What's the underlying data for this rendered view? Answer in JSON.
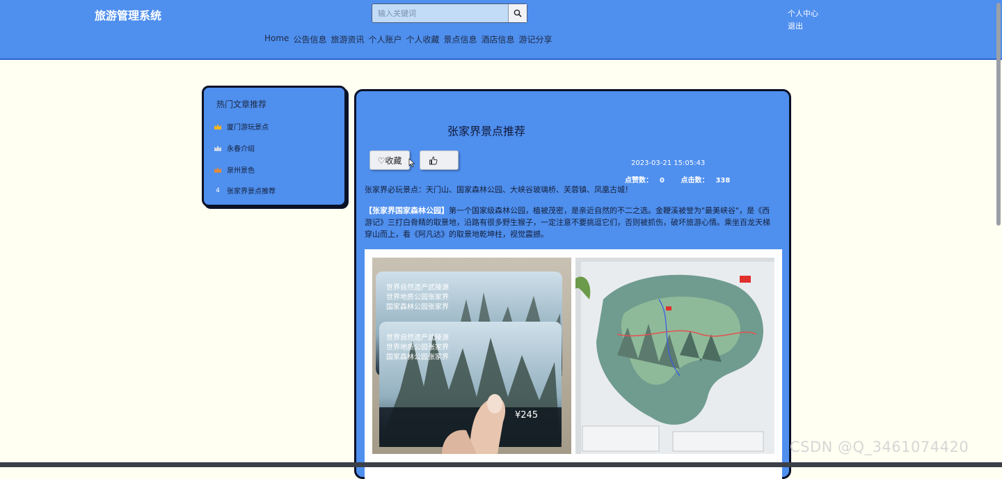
{
  "header": {
    "site_title": "旅游管理系统",
    "search_placeholder": "输入关键词",
    "nav": [
      "Home",
      "公告信息",
      "旅游资讯",
      "个人账户",
      "个人收藏",
      "景点信息",
      "酒店信息",
      "游记分享"
    ],
    "user_links": [
      "个人中心",
      "退出"
    ]
  },
  "sidebar": {
    "title": "热门文章推荐",
    "items": [
      {
        "rank": "1",
        "label": "厦门游玩景点"
      },
      {
        "rank": "2",
        "label": "永春介绍"
      },
      {
        "rank": "3",
        "label": "泉州景色"
      },
      {
        "rank": "4",
        "label": "张家界景点推荐"
      }
    ],
    "rank_colors": [
      "#f5b520",
      "#c9d2e0",
      "#e08a3c"
    ]
  },
  "article": {
    "title": "张家界景点推荐",
    "favorite_label": "♡收藏",
    "like_label": "👍",
    "date": "2023-03-21 15:05:43",
    "likes_label": "点赞数：",
    "likes": "0",
    "clicks_label": "点击数：",
    "clicks": "338",
    "intro": "张家界必玩景点：天门山、国家森林公园、大峡谷玻璃桥、芙蓉镇、凤凰古城！",
    "para2_lead": "【张家界国家森林公园】",
    "para2_text": "第一个国家级森林公园，植被茂密，是亲近自然的不二之选。金鞭溪被誉为\"最美峡谷\"，是《西游记》三打白骨精的取景地，沿路有很多野生猴子，一定注意不要挑逗它们，否则被抓伤，破坏旅游心情。乘坐百龙天梯穿山而上，看《阿凡达》的取景地乾坤柱，视觉震撼。",
    "ticket_text_lines": [
      "世界自然遗产武陵源",
      "世界地质公园张家界",
      "国家森林公园张家界"
    ],
    "ticket_price": "¥245"
  },
  "watermark": "CSDN @Q_3461074420"
}
